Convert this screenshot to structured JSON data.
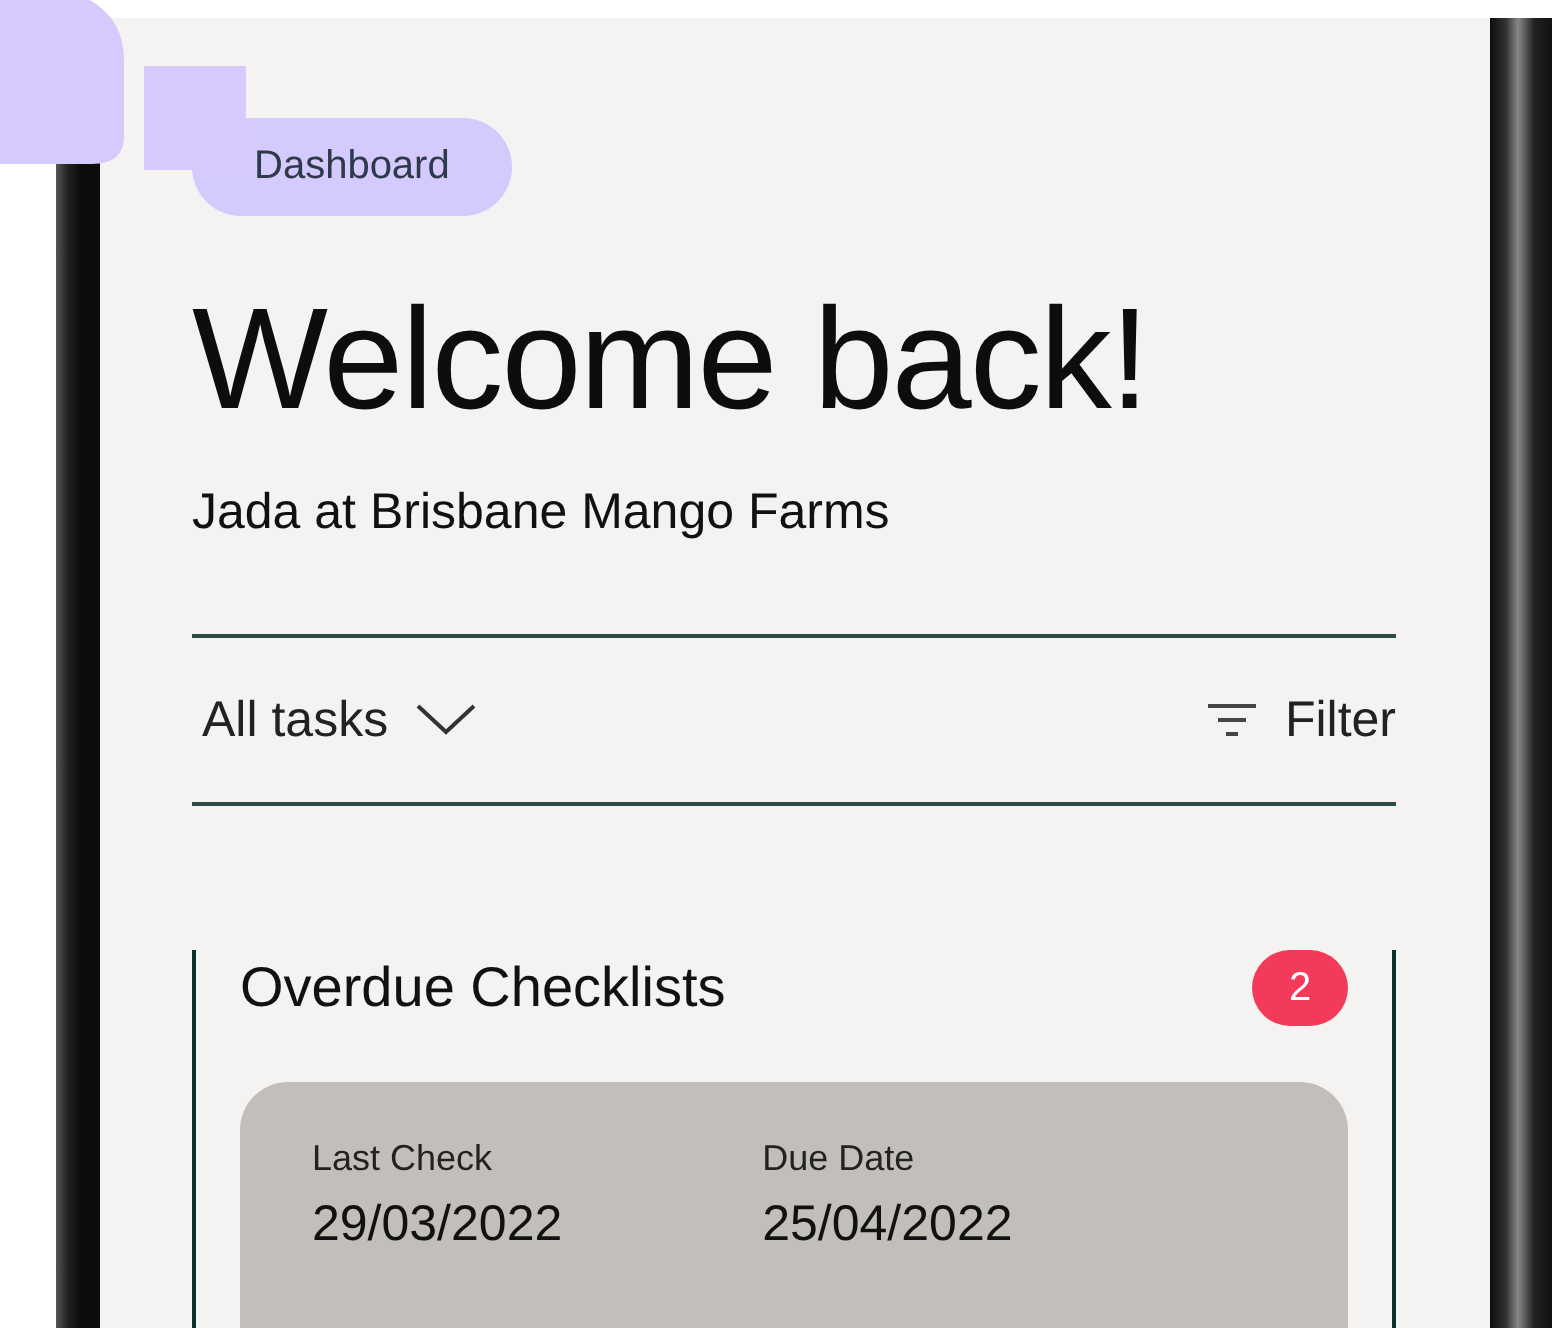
{
  "badge": {
    "label": "Dashboard"
  },
  "heading": {
    "title": "Welcome back!",
    "subtitle": "Jada at Brisbane Mango Farms"
  },
  "toolbar": {
    "dropdown": "All tasks",
    "filter": "Filter"
  },
  "section": {
    "title": "Overdue Checklists",
    "count": "2",
    "card": {
      "fields": [
        {
          "label": "Last Check",
          "value": "29/03/2022"
        },
        {
          "label": "Due Date",
          "value": "25/04/2022"
        }
      ]
    }
  }
}
